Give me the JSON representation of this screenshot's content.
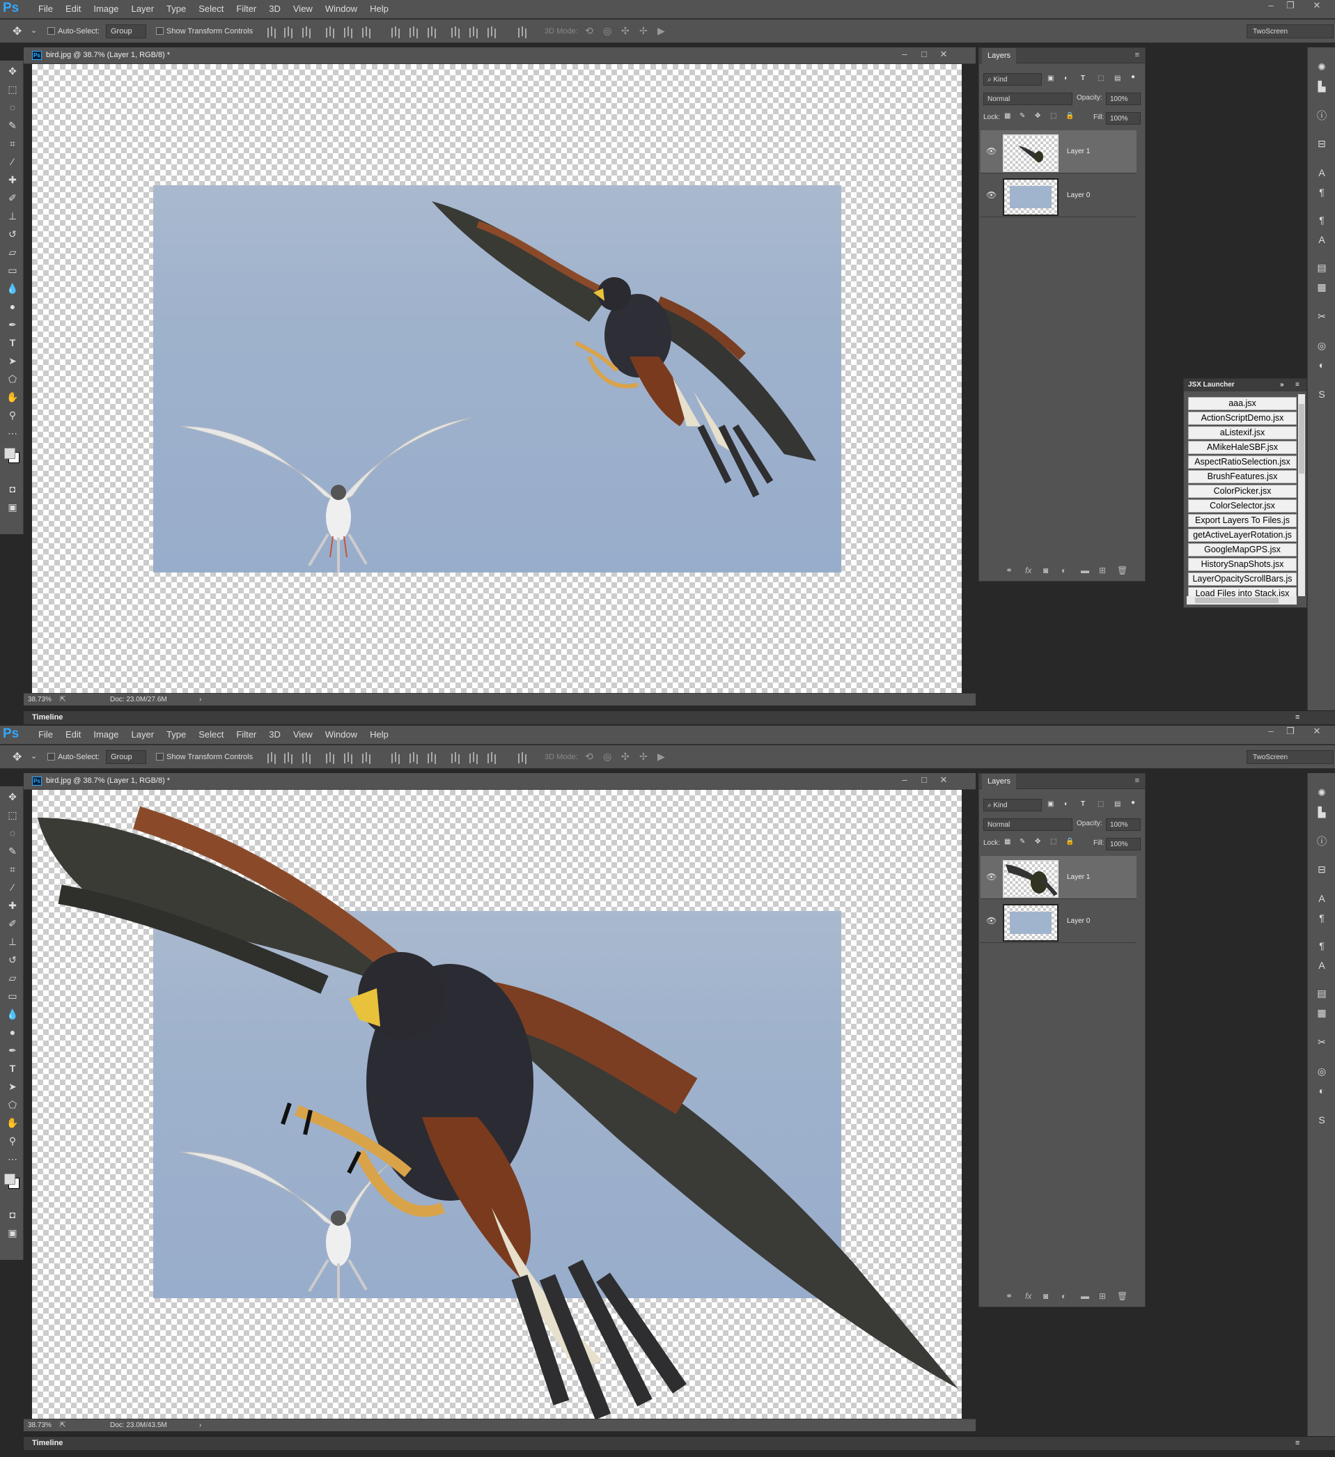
{
  "app": {
    "logo": "Ps",
    "menus": [
      "File",
      "Edit",
      "Image",
      "Layer",
      "Type",
      "Select",
      "Filter",
      "3D",
      "View",
      "Window",
      "Help"
    ]
  },
  "options": {
    "auto_select_label": "Auto-Select:",
    "auto_select_value": "Group",
    "transform_label": "Show Transform Controls",
    "mode_label": "3D Mode:",
    "workspace": "TwoScreen"
  },
  "layers_panel": {
    "tab": "Layers",
    "filter": "Kind",
    "blend": "Normal",
    "opacity_label": "Opacity:",
    "opacity": "100%",
    "lock_label": "Lock:",
    "fill_label": "Fill:",
    "fill": "100%",
    "layers": [
      "Layer 1",
      "Layer 0"
    ]
  },
  "timeline": "Timeline",
  "jsx": {
    "title": "JSX Launcher",
    "scripts": [
      "aaa.jsx",
      "ActionScriptDemo.jsx",
      "aListexif.jsx",
      "AMikeHaleSBF.jsx",
      "AspectRatioSelection.jsx",
      "BrushFeatures.jsx",
      "ColorPicker.jsx",
      "ColorSelector.jsx",
      "Export Layers To Files.js",
      "getActiveLayerRotation.js",
      "GoogleMapGPS.jsx",
      "HistorySnapShots.jsx",
      "LayerOpacityScrollBars.js",
      "Load Files into Stack.jsx"
    ]
  },
  "screens": [
    {
      "doc_title": "bird.jpg @ 38.7% (Layer 1, RGB/8) *",
      "zoom": "38.73%",
      "doc_size": "Doc: 23.0M/27.6M"
    },
    {
      "doc_title": "bird.jpg @ 38.7% (Layer 1, RGB/8) *",
      "zoom": "38.73%",
      "doc_size": "Doc: 23.0M/43.5M"
    }
  ],
  "colors": {
    "accent": "#31a8ff",
    "panel": "#535353",
    "dark": "#282828"
  }
}
